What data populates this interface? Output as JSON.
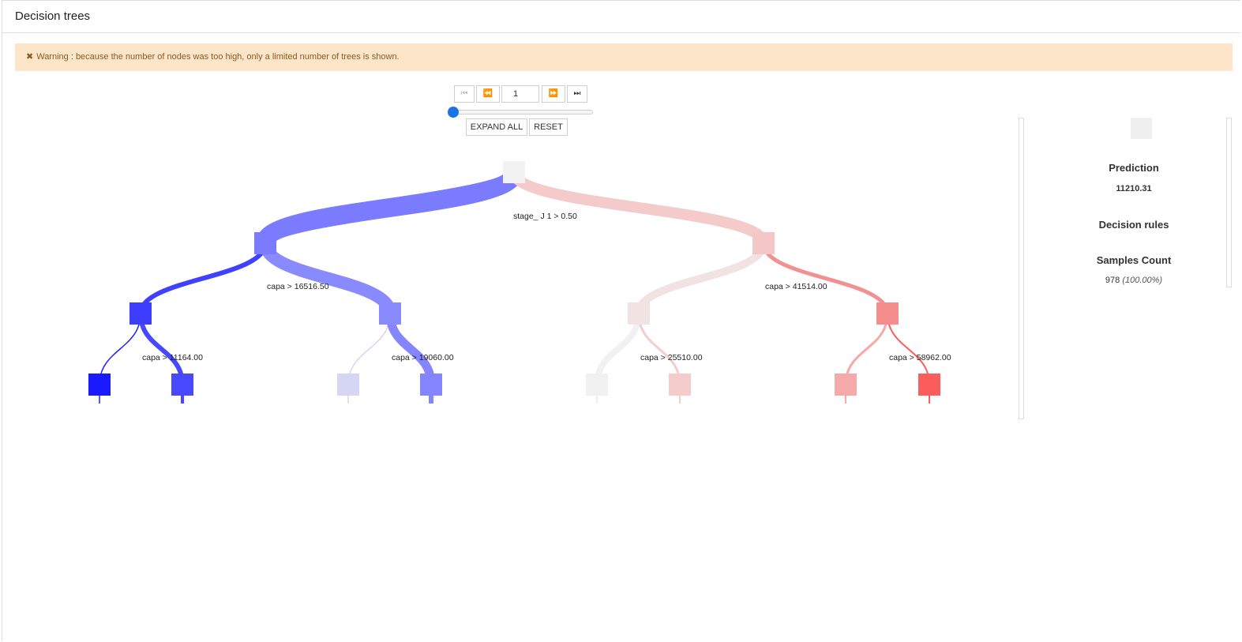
{
  "header": {
    "title": "Decision trees"
  },
  "warning": {
    "icon": "close-icon",
    "text": "Warning : because the number of nodes was too high, only a limited number of trees is shown."
  },
  "pager": {
    "page": "1",
    "first": "first-page-icon",
    "prev": "prev-page-icon",
    "next": "next-page-icon",
    "last": "last-page-icon"
  },
  "controls": {
    "expand_all": "EXPAND ALL",
    "reset": "RESET"
  },
  "tree": {
    "colors": {
      "left": "#4c4cff",
      "right": "#f08080",
      "neutral": "#f2f2f2"
    },
    "splits": {
      "root": "stage_ J 1 > 0.50",
      "l": "capa > 16516.50",
      "r": "capa > 41514.00",
      "ll": "capa > 11164.00",
      "lr": "capa > 19060.00",
      "rl": "capa > 25510.00",
      "rr": "capa > 58962.00"
    }
  },
  "side": {
    "prediction_label": "Prediction",
    "prediction_value": "11210.31",
    "rules_label": "Decision rules",
    "samples_label": "Samples Count",
    "samples_value": "978",
    "samples_pct": "(100.00%)"
  }
}
